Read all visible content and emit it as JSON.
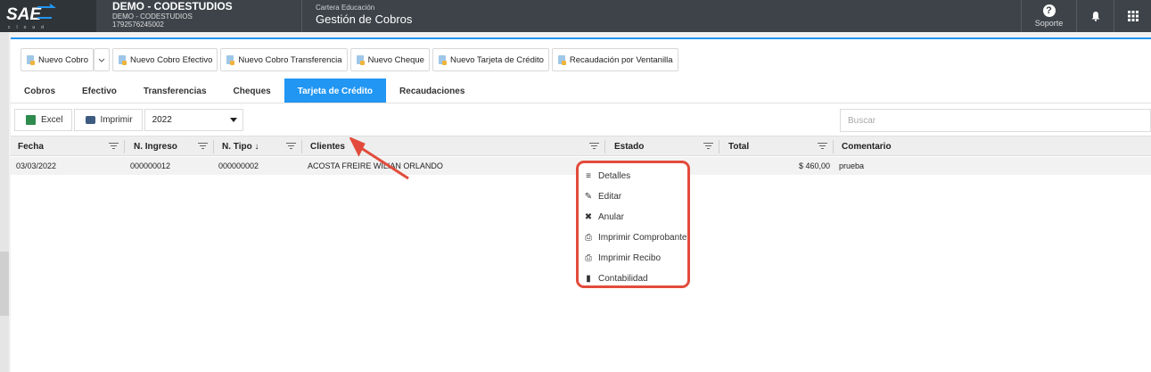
{
  "header": {
    "logo_text": "SAE",
    "logo_sub": "cloud",
    "company_name": "DEMO - CODESTUDIOS",
    "company_sub": "DEMO - CODESTUDIOS",
    "company_ruc": "1792576245002",
    "module_category": "Cartera Educación",
    "module_title": "Gestión de Cobros",
    "support_label": "Soporte"
  },
  "toolbar": {
    "buttons": [
      "Nuevo Cobro",
      "Nuevo Cobro Efectivo",
      "Nuevo Cobro Transferencia",
      "Nuevo Cheque",
      "Nuevo Tarjeta de Crédito",
      "Recaudación por Ventanilla"
    ]
  },
  "tabs": [
    {
      "label": "Cobros",
      "active": false
    },
    {
      "label": "Efectivo",
      "active": false
    },
    {
      "label": "Transferencias",
      "active": false
    },
    {
      "label": "Cheques",
      "active": false
    },
    {
      "label": "Tarjeta de Crédito",
      "active": true
    },
    {
      "label": "Recaudaciones",
      "active": false
    }
  ],
  "actions": {
    "excel": "Excel",
    "print": "Imprimir",
    "year": "2022",
    "search_placeholder": "Buscar"
  },
  "table": {
    "columns": [
      "Fecha",
      "N. Ingreso",
      "N. Tipo ↓",
      "Clientes",
      "Estado",
      "Total",
      "Comentario"
    ],
    "rows": [
      {
        "fecha": "03/03/2022",
        "ingreso": "000000012",
        "tipo": "000000002",
        "cliente": "ACOSTA FREIRE WILIAN ORLANDO",
        "estado": "",
        "total": "$ 460,00",
        "comentario": "prueba"
      }
    ]
  },
  "context_menu": [
    {
      "label": "Detalles",
      "icon": "list-icon"
    },
    {
      "label": "Editar",
      "icon": "pencil-icon"
    },
    {
      "label": "Anular",
      "icon": "close-icon"
    },
    {
      "label": "Imprimir Comprobante",
      "icon": "printer-icon"
    },
    {
      "label": "Imprimir Recibo",
      "icon": "printer-icon"
    },
    {
      "label": "Contabilidad",
      "icon": "book-icon"
    }
  ],
  "colors": {
    "accent": "#2196f3",
    "topbar": "#3d4349",
    "highlight": "#e24b3b"
  }
}
